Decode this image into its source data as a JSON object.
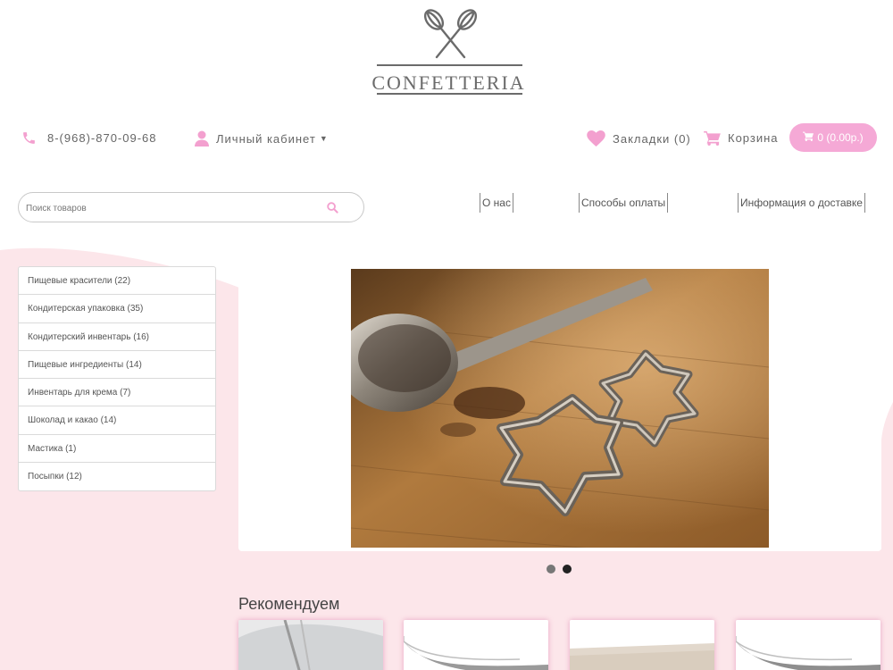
{
  "brand": {
    "name": "CONFETTERIA",
    "logo_icon": "crossed-whisks-icon"
  },
  "topbar": {
    "phone": "8-(968)-870-09-68",
    "account_label": "Личный кабинет",
    "bookmarks_label": "Закладки (0)",
    "cart_label": "Корзина",
    "cart_button": "0 (0.00р.)"
  },
  "search": {
    "placeholder": "Поиск товаров",
    "value": ""
  },
  "info_links": [
    "О нас",
    "Способы оплаты",
    "Информация о доставке"
  ],
  "categories": [
    "Пищевые красители (22)",
    "Кондитерская упаковка (35)",
    "Кондитерский инвентарь (16)",
    "Пищевые ингредиенты (14)",
    "Инвентарь для крема (7)",
    "Шоколад и какао (14)",
    "Мастика (1)",
    "Посыпки (12)"
  ],
  "slider": {
    "image": "ladle-and-star-cookie-cutters",
    "slides": 2,
    "active_slide": 2
  },
  "recommended": {
    "title": "Рекомендуем",
    "products": [
      {
        "image": "glass-product"
      },
      {
        "image": "grey-spatula-product"
      },
      {
        "image": "powder-product"
      },
      {
        "image": "grey-spatula-product"
      }
    ]
  },
  "colors": {
    "accent": "#f5a9d6",
    "background_pink": "#fce6ea",
    "text": "#555555"
  }
}
